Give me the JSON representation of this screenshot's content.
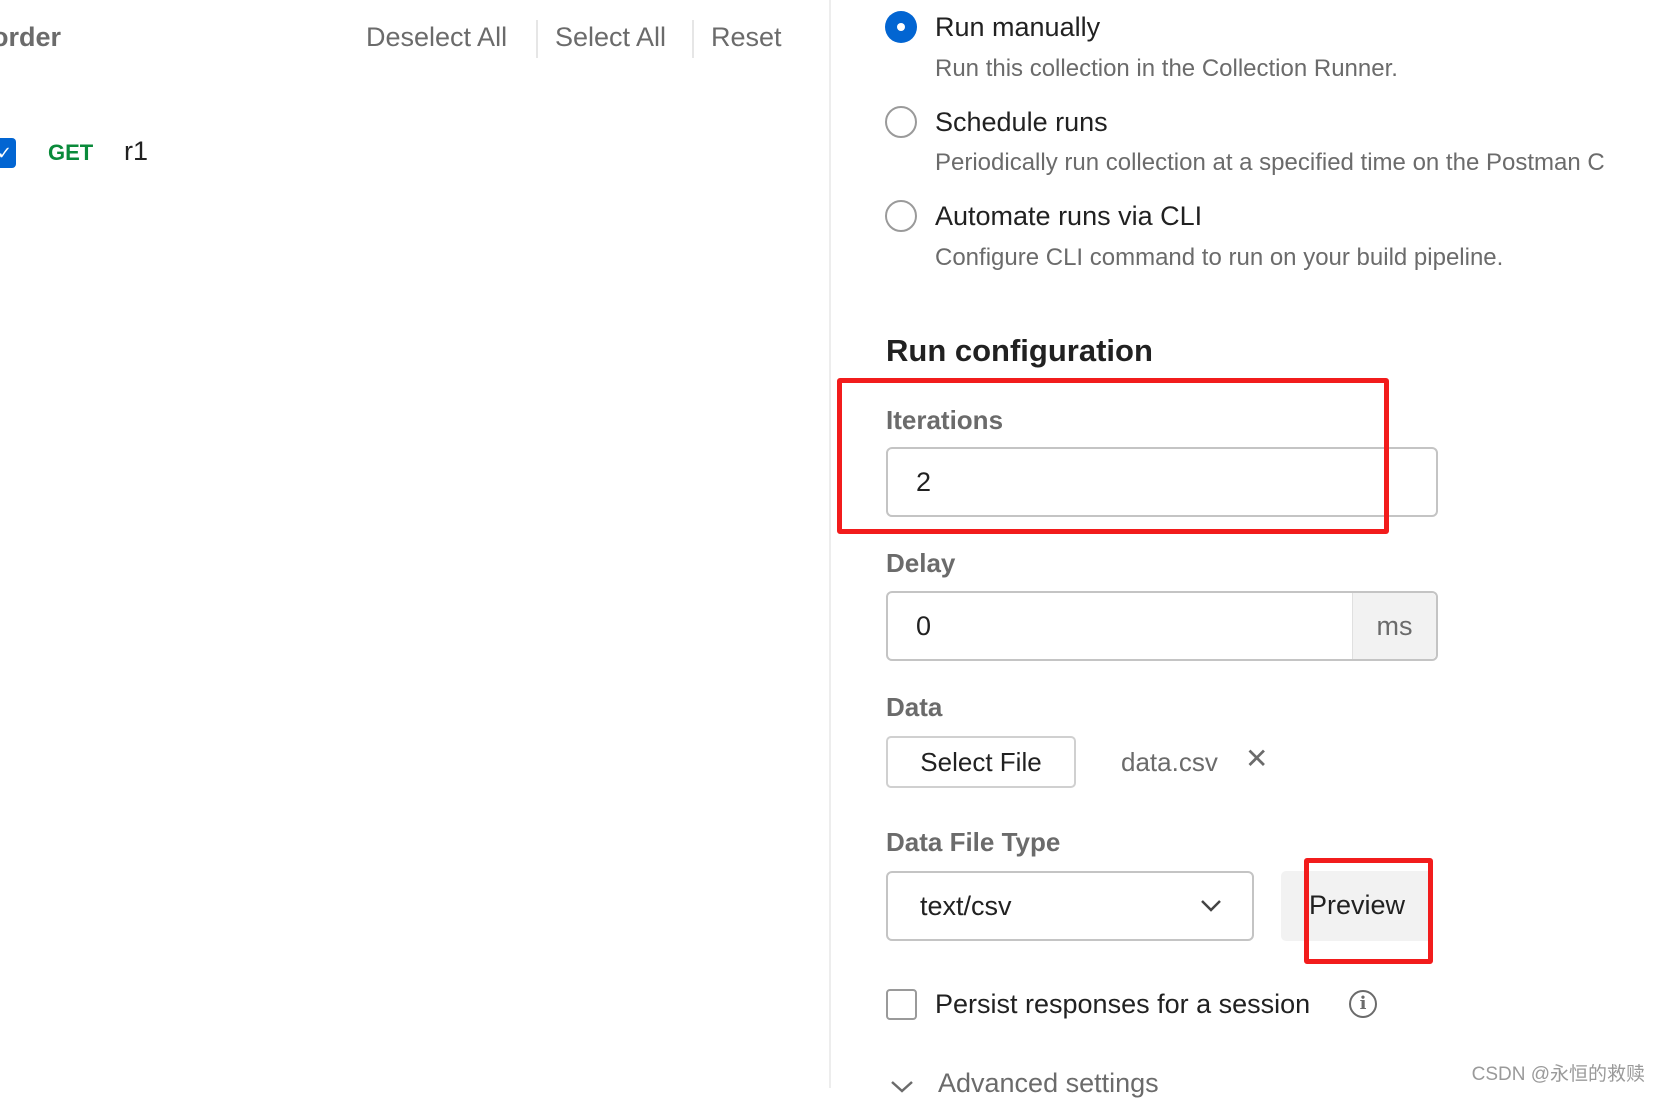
{
  "left": {
    "heading": "order",
    "actions": [
      "Deselect All",
      "Select All",
      "Reset"
    ],
    "requests": [
      {
        "method": "GET",
        "name": "r1",
        "checked": true
      }
    ]
  },
  "run_modes": [
    {
      "label": "Run manually",
      "description": "Run this collection in the Collection Runner.",
      "selected": true
    },
    {
      "label": "Schedule runs",
      "description": "Periodically run collection at a specified time on the Postman C",
      "selected": false
    },
    {
      "label": "Automate runs via CLI",
      "description": "Configure CLI command to run on your build pipeline.",
      "selected": false
    }
  ],
  "config": {
    "title": "Run configuration",
    "iterations_label": "Iterations",
    "iterations": "2",
    "delay_label": "Delay",
    "delay": "0",
    "delay_unit": "ms",
    "data_label": "Data",
    "select_file": "Select File",
    "file_name": "data.csv",
    "file_type_label": "Data File Type",
    "file_type": "text/csv",
    "preview": "Preview",
    "persist_label": "Persist responses for a session",
    "persist_checked": false,
    "advanced": "Advanced settings"
  },
  "watermark": "CSDN @永恒的救赎",
  "colors": {
    "accent": "#0265d2",
    "get": "#0a8a3a",
    "highlight": "#f21c1c"
  }
}
